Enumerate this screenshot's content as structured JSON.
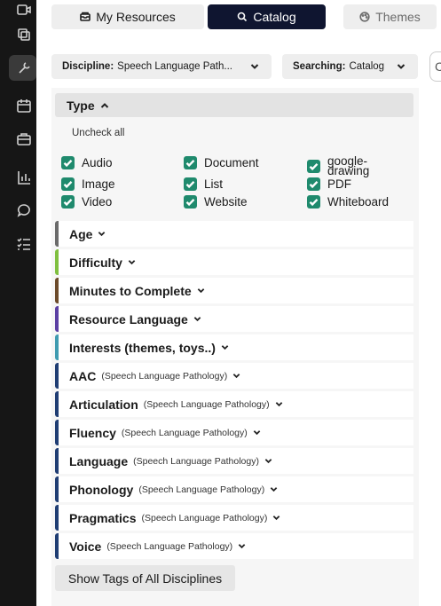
{
  "tabs": {
    "my_resources": "My Resources",
    "catalog": "Catalog",
    "themes": "Themes"
  },
  "filters": {
    "discipline_label": "Discipline:",
    "discipline_value": "Speech Language Path...",
    "searching_label": "Searching:",
    "searching_value": "Catalog"
  },
  "type_section": {
    "title": "Type",
    "uncheck_all": "Uncheck all",
    "options": [
      {
        "label": "Audio",
        "checked": true
      },
      {
        "label": "Document",
        "checked": true
      },
      {
        "label": "google-drawing",
        "checked": true
      },
      {
        "label": "Image",
        "checked": true
      },
      {
        "label": "List",
        "checked": true
      },
      {
        "label": "PDF",
        "checked": true
      },
      {
        "label": "Video",
        "checked": true
      },
      {
        "label": "Website",
        "checked": true
      },
      {
        "label": "Whiteboard",
        "checked": true
      }
    ]
  },
  "sections": [
    {
      "title": "Age",
      "sub": "",
      "color": "#6a6a6a"
    },
    {
      "title": "Difficulty",
      "sub": "",
      "color": "#7fbf3f"
    },
    {
      "title": "Minutes to Complete",
      "sub": "",
      "color": "#6b4a2a"
    },
    {
      "title": "Resource Language",
      "sub": "",
      "color": "#5b3fa3"
    },
    {
      "title": "Interests (themes, toys..)",
      "sub": "",
      "color": "#3f9bb0"
    },
    {
      "title": "AAC",
      "sub": "(Speech Language Pathology)",
      "color": "#1f3d73"
    },
    {
      "title": "Articulation",
      "sub": "(Speech Language Pathology)",
      "color": "#1f3d73"
    },
    {
      "title": "Fluency",
      "sub": "(Speech Language Pathology)",
      "color": "#1f3d73"
    },
    {
      "title": "Language",
      "sub": "(Speech Language Pathology)",
      "color": "#1f3d73"
    },
    {
      "title": "Phonology",
      "sub": "(Speech Language Pathology)",
      "color": "#1f3d73"
    },
    {
      "title": "Pragmatics",
      "sub": "(Speech Language Pathology)",
      "color": "#1f3d73"
    },
    {
      "title": "Voice",
      "sub": "(Speech Language Pathology)",
      "color": "#1f3d73"
    }
  ],
  "show_tags_button": "Show Tags of All Disciplines",
  "colors": {
    "rail": "#161616",
    "active_tab": "#0f1530",
    "checkbox": "#1f8a6d"
  }
}
